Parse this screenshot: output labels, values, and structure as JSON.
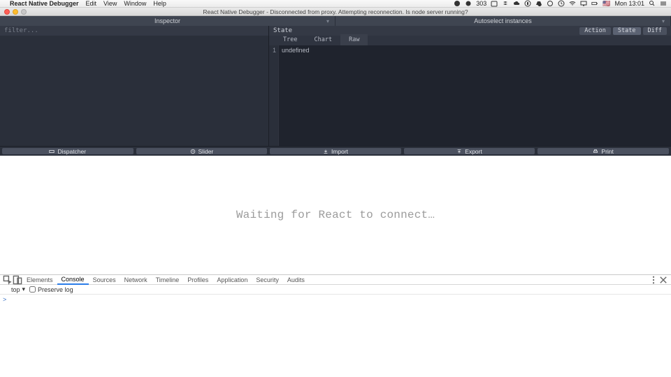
{
  "menubar": {
    "app_name": "React Native Debugger",
    "items": [
      "Edit",
      "View",
      "Window",
      "Help"
    ],
    "right": {
      "count": "303",
      "clock": "Mon 13:01",
      "flag": "🇺🇸"
    }
  },
  "window": {
    "title": "React Native Debugger - Disconnected from proxy. Attempting reconnection. Is node server running?"
  },
  "debugger": {
    "left_header": "Inspector",
    "right_header": "Autoselect instances",
    "filter_placeholder": "filter...",
    "state_title": "State",
    "seg": {
      "action": "Action",
      "state": "State",
      "diff": "Diff"
    },
    "subtabs": {
      "tree": "Tree",
      "chart": "Chart",
      "raw": "Raw"
    },
    "code": {
      "line_no": "1",
      "content": "undefined"
    },
    "actions": {
      "dispatcher": "Dispatcher",
      "slider": "Slider",
      "import": "Import",
      "export": "Export",
      "print": "Print"
    }
  },
  "waiting_text": "Waiting for React to connect…",
  "devtools": {
    "tabs": [
      "Elements",
      "Console",
      "Sources",
      "Network",
      "Timeline",
      "Profiles",
      "Application",
      "Security",
      "Audits"
    ],
    "active_tab_index": 1,
    "toolbar": {
      "context": "top",
      "preserve_log_label": "Preserve log"
    },
    "prompt": ">"
  }
}
